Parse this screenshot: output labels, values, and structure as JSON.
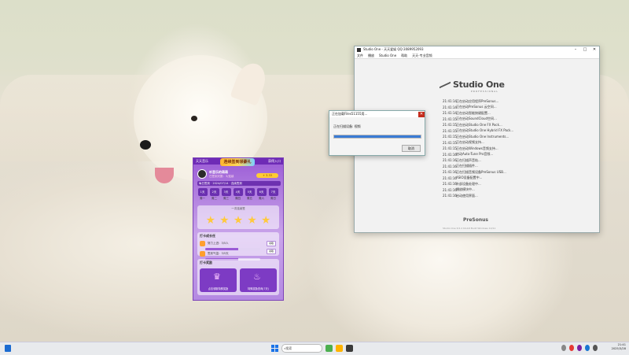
{
  "studio_one": {
    "title": "Studio One - 天天爱娱 QQ:3089952093",
    "menu": [
      "文件",
      "播放",
      "Studio One",
      "帮助",
      "天天-专业音频"
    ],
    "logo_name": "Studio One",
    "logo_sub": "PROFESSIONAL",
    "log": [
      {
        "time": "21:41:14",
        "text": "正在启动应用程序PreSonus..."
      },
      {
        "time": "21:41:14",
        "text": "正在启动PreSonus 云空间..."
      },
      {
        "time": "21:41:14",
        "text": "正在启动智能按键配置..."
      },
      {
        "time": "21:41:15",
        "text": "正在启动SoundCloud空间..."
      },
      {
        "time": "21:41:15",
        "text": "正在启动Studio One FX Pack..."
      },
      {
        "time": "21:41:15",
        "text": "正在启动Studio One Hybrid FX Pack..."
      },
      {
        "time": "21:41:15",
        "text": "正在启动Studio One Instruments..."
      },
      {
        "time": "21:41:15",
        "text": "正在启动视频支持..."
      },
      {
        "time": "21:41:15",
        "text": "正在启动Windows音频支持..."
      },
      {
        "time": "21:41:16",
        "text": "启动Auto-Tune Pro音频..."
      },
      {
        "time": "21:41:16",
        "text": "正在扫描声音轨..."
      },
      {
        "time": "21:41:16",
        "text": "正在扫描插件..."
      },
      {
        "time": "21:41:16",
        "text": "正在扫描音频设备PreSonus USB..."
      },
      {
        "time": "21:41:16",
        "text": "ASIO设备配置中..."
      },
      {
        "time": "21:41:16",
        "text": "外部设备处理中..."
      },
      {
        "time": "21:41:16",
        "text": "播放模块中..."
      },
      {
        "time": "21:41:16",
        "text": "启动使用界面..."
      }
    ],
    "brand": "PreSonus",
    "version": "Studio One 6.5.2 64-bit Build Windows 10/11"
  },
  "scan_dialog": {
    "title": "正在加载Files51155用...",
    "message": "正在扫描设备: 视频",
    "progress": 1.0,
    "cancel_label": "取消"
  },
  "purple_app": {
    "top_left": "天天音乐",
    "top_right": "获得入口",
    "banner": "连续签到领豪礼",
    "user_name": "听音乐的萌萌",
    "user_level": "已签到天数：3/连续",
    "vip_label": "+ 3.33",
    "strip": "每日签到 · 2024/07/14 · 连续签到",
    "days": [
      {
        "box": "1天",
        "label": "周一"
      },
      {
        "box": "2天",
        "label": "周二"
      },
      {
        "box": "3天",
        "label": "周三"
      },
      {
        "box": "4天",
        "label": "周四"
      },
      {
        "box": "5天",
        "label": "周五"
      },
      {
        "box": "6天",
        "label": "周六"
      },
      {
        "box": "7天",
        "label": "周日"
      }
    ],
    "stars_title": "一次连续签",
    "section1": "打卡成长任",
    "task1": "努力上进：3/5人",
    "task1_progress": 0.6,
    "task2": "签到气温：3/5天",
    "task2_progress": 0.6,
    "task_btn": "领取",
    "section2": "打卡奖励",
    "tile1": "点击领取特殊奖励",
    "tile2": "特殊奖励查询(7天)"
  },
  "taskbar": {
    "search_placeholder": "搜索",
    "time": "21:41",
    "date": "2025/3/28"
  }
}
